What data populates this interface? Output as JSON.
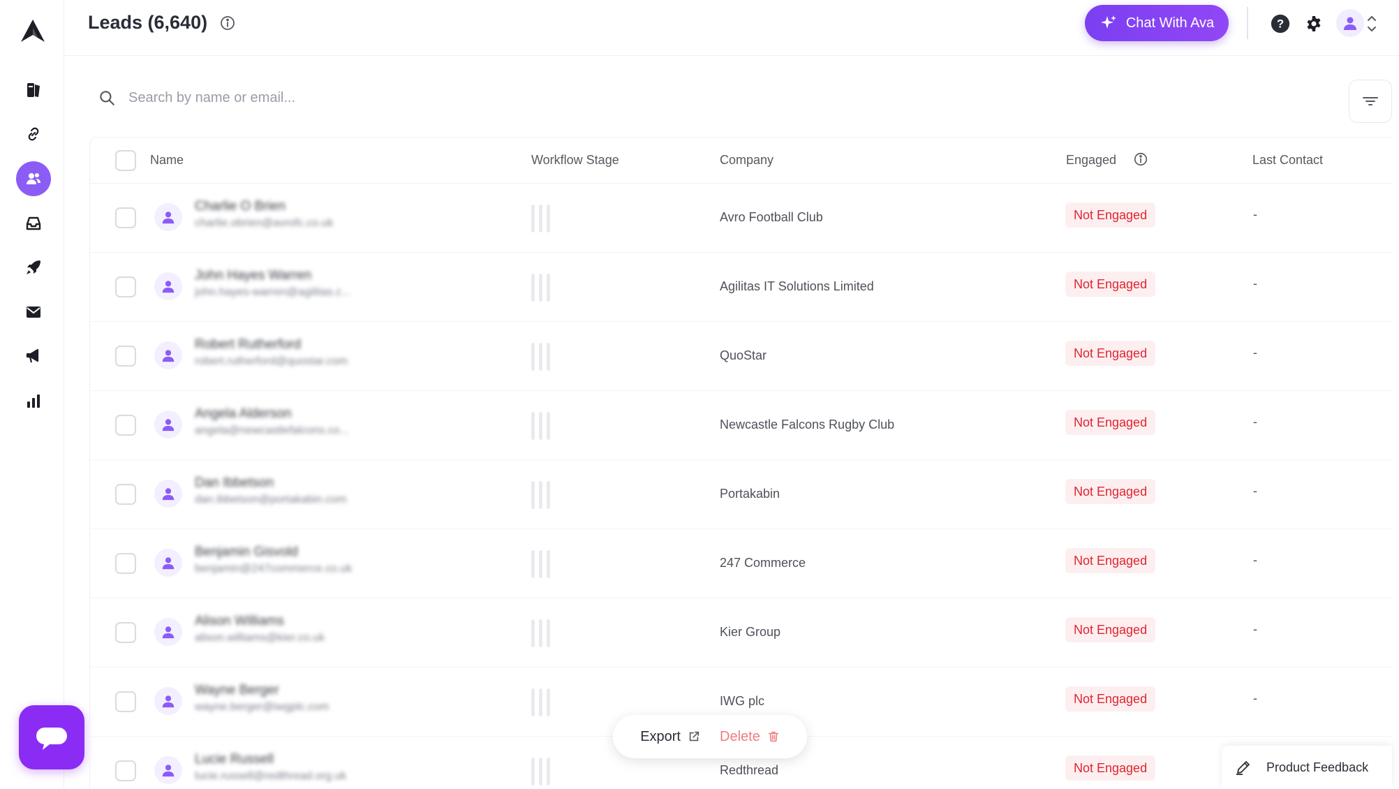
{
  "header": {
    "title": "Leads (6,640)",
    "chat_button_label": "Chat With Ava"
  },
  "search": {
    "placeholder": "Search by name or email..."
  },
  "table": {
    "columns": {
      "name": "Name",
      "workflow_stage": "Workflow Stage",
      "company": "Company",
      "engaged": "Engaged",
      "last_contact": "Last Contact"
    },
    "rows": [
      {
        "name": "Charlie O Brien",
        "email": "charlie.obrien@avrofc.co.uk",
        "company": "Avro Football Club",
        "engaged": "Not Engaged",
        "last_contact": "-"
      },
      {
        "name": "John Hayes Warren",
        "email": "john.hayes-warren@agilitas.c...",
        "company": "Agilitas IT Solutions Limited",
        "engaged": "Not Engaged",
        "last_contact": "-"
      },
      {
        "name": "Robert Rutherford",
        "email": "robert.rutherford@quostar.com",
        "company": "QuoStar",
        "engaged": "Not Engaged",
        "last_contact": "-"
      },
      {
        "name": "Angela Alderson",
        "email": "angela@newcastlefalcons.co...",
        "company": "Newcastle Falcons Rugby Club",
        "engaged": "Not Engaged",
        "last_contact": "-"
      },
      {
        "name": "Dan Ibbetson",
        "email": "dan.ibbetson@portakabin.com",
        "company": "Portakabin",
        "engaged": "Not Engaged",
        "last_contact": "-"
      },
      {
        "name": "Benjamin Gisvold",
        "email": "benjamin@247commerce.co.uk",
        "company": "247 Commerce",
        "engaged": "Not Engaged",
        "last_contact": "-"
      },
      {
        "name": "Alison Williams",
        "email": "alison.williams@kier.co.uk",
        "company": "Kier Group",
        "engaged": "Not Engaged",
        "last_contact": "-"
      },
      {
        "name": "Wayne Berger",
        "email": "wayne.berger@iwgplc.com",
        "company": "IWG plc",
        "engaged": "Not Engaged",
        "last_contact": "-"
      },
      {
        "name": "Lucie Russell",
        "email": "lucie.russell@redthread.org.uk",
        "company": "Redthread",
        "engaged": "Not Engaged",
        "last_contact": "-"
      }
    ]
  },
  "actions": {
    "export_label": "Export",
    "delete_label": "Delete"
  },
  "feedback": {
    "label": "Product Feedback"
  },
  "colors": {
    "accent": "#8b5cf6",
    "danger": "#e0242f",
    "danger_bg": "#fdeff0"
  },
  "icons": [
    "logo-icon",
    "contacts-book-icon",
    "link-icon",
    "users-icon",
    "inbox-icon",
    "rocket-icon",
    "mail-icon",
    "megaphone-icon",
    "bar-chart-icon",
    "info-icon",
    "sparkle-icon",
    "help-icon",
    "gear-icon",
    "user-icon",
    "chevron-updown-icon",
    "search-icon",
    "filter-icon",
    "external-link-icon",
    "trash-icon",
    "pencil-icon",
    "chat-icon"
  ]
}
